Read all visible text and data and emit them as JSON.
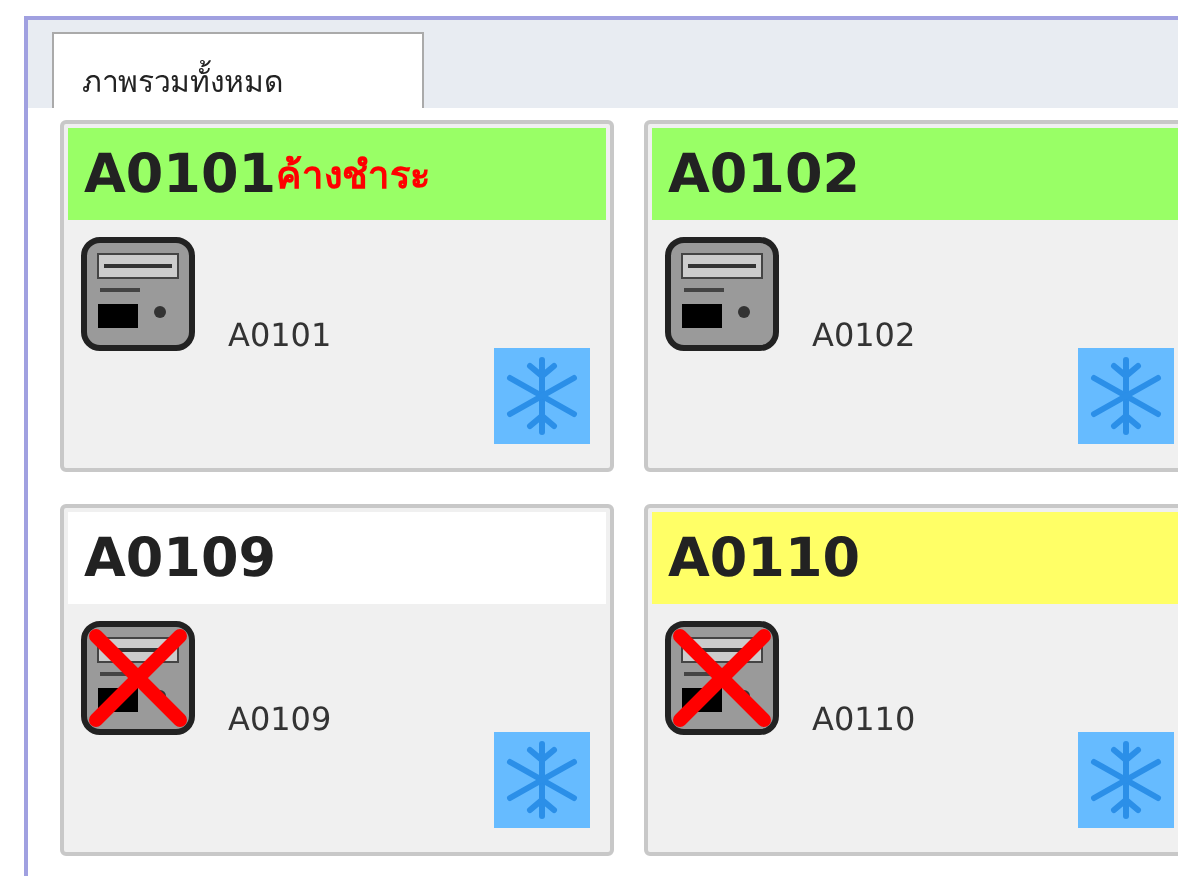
{
  "tabs": [
    {
      "label": "ภาพรวมทั้งหมด",
      "selected": true
    }
  ],
  "cards": [
    {
      "title": "A0101",
      "status": "ค้างชำระ",
      "color": "#99ff66",
      "kind": "online",
      "label": "A0101"
    },
    {
      "title": "A0102",
      "color": "#99ff66",
      "kind": "online",
      "label": "A0102"
    },
    {
      "title": "A0109",
      "color": "#ffffff",
      "kind": "offline",
      "label": "A0109"
    },
    {
      "title": "A0110",
      "color": "#ffff66",
      "kind": "offline",
      "label": "A0110"
    }
  ]
}
